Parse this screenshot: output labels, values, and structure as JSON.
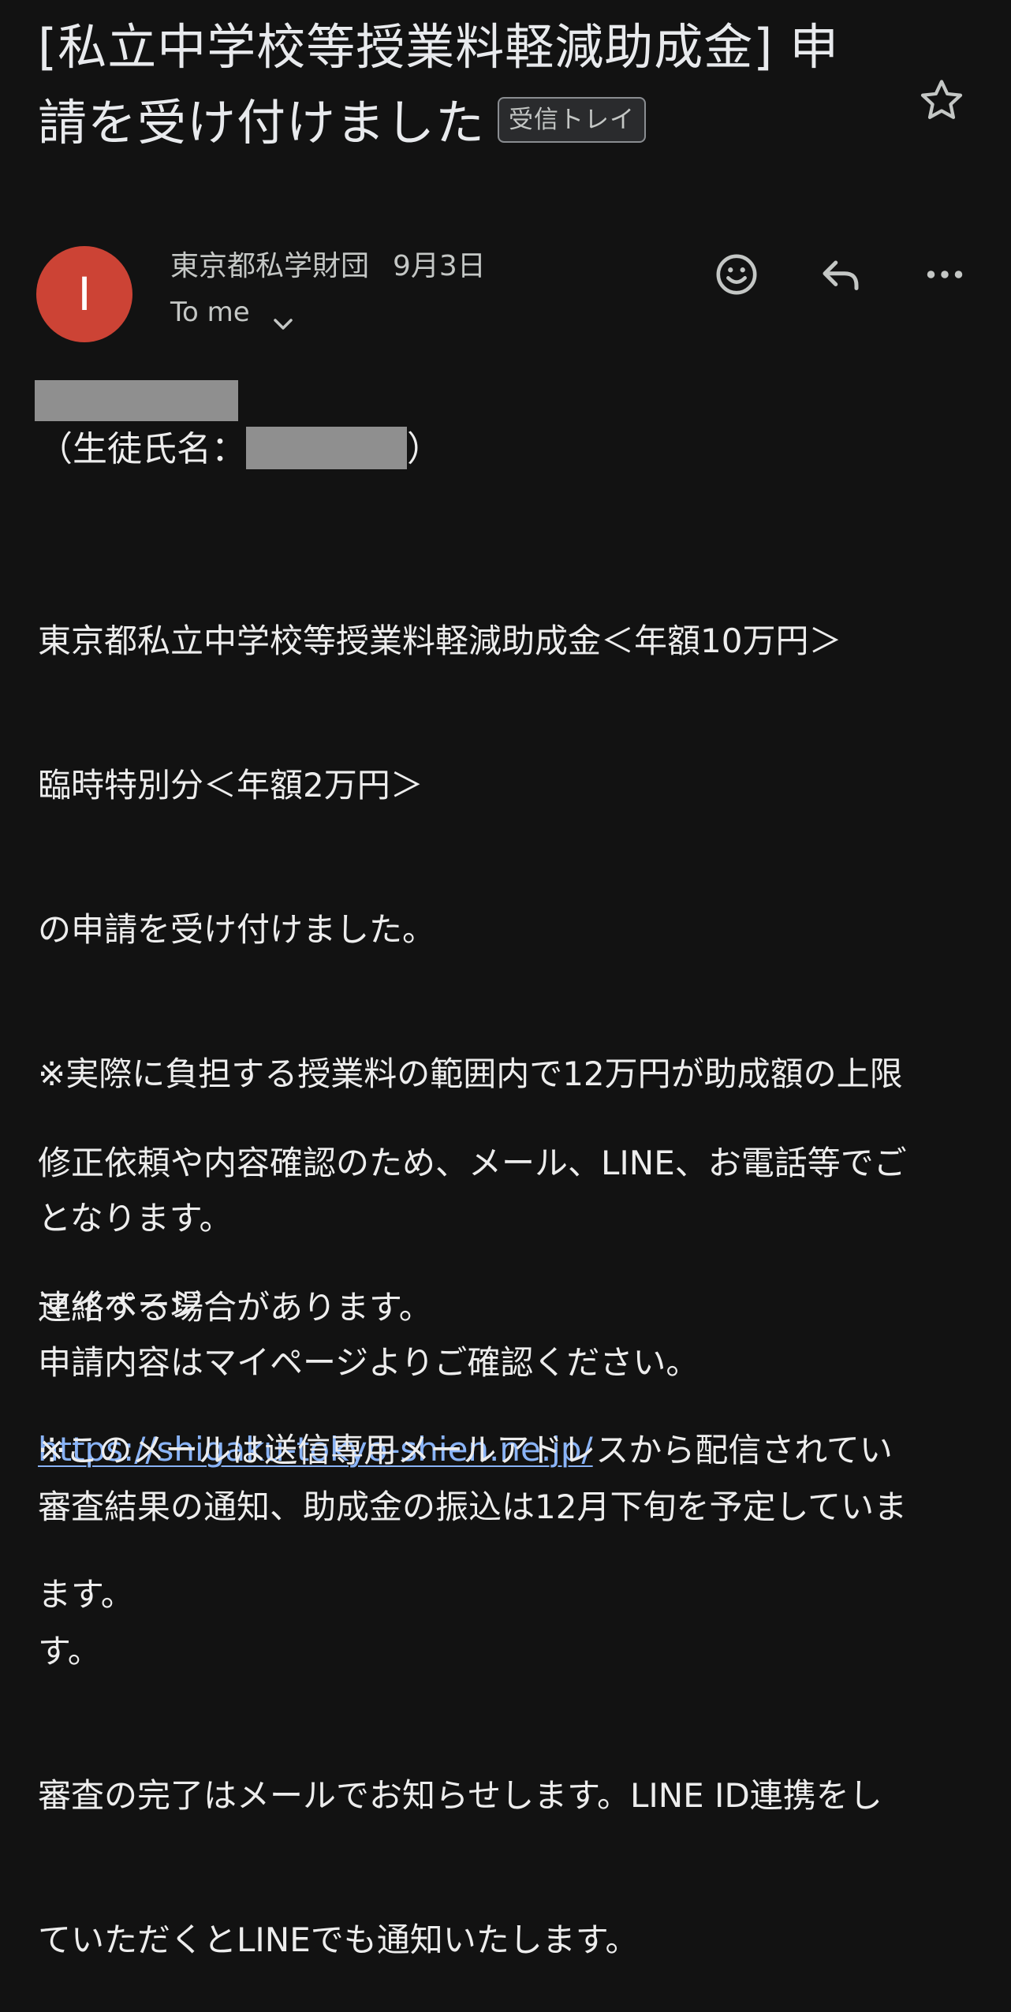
{
  "subject": {
    "line1": "[私立中学校等授業料軽減助成金] 申",
    "line2": "請を受け付けました",
    "label": "受信トレイ"
  },
  "header": {
    "avatar_letter": "I",
    "avatar_color": "#cc4335",
    "sender": "東京都私学財団",
    "date": "9月3日",
    "recipient": "To me"
  },
  "icons": {
    "star": "star-icon",
    "emoji": "emoji-reaction-icon",
    "reply": "reply-icon",
    "more": "more-horizontal-icon",
    "chevron": "chevron-down-icon"
  },
  "body": {
    "student_prefix": "（生徒氏名：",
    "student_suffix": "）",
    "main_lines": [
      "東京都私立中学校等授業料軽減助成金＜年額10万円＞",
      "臨時特別分＜年額2万円＞",
      "の申請を受け付けました。",
      "※実際に負担する授業料の範囲内で12万円が助成額の上限",
      "となります。",
      "申請内容はマイページよりご確認ください。",
      "審査結果の通知、助成金の振込は12月下旬を予定していま",
      "す。",
      "審査の完了はメールでお知らせします。LINE ID連携をし",
      "ていただくとLINEでも通知いたします。"
    ],
    "contact_lines": [
      "修正依頼や内容確認のため、メール、LINE、お電話等でご",
      "連絡する場合があります。"
    ],
    "mypage_label": "マイページ",
    "mypage_url": "https://shigaku-tokyo-shien.ne.jp/",
    "footer_lines": [
      "※このメールは送信専用メールアドレスから配信されてい",
      "ます。"
    ]
  },
  "colors": {
    "background": "#121212",
    "text": "#ededed",
    "link": "#8ab4f8",
    "redaction": "#8f8f8f"
  }
}
